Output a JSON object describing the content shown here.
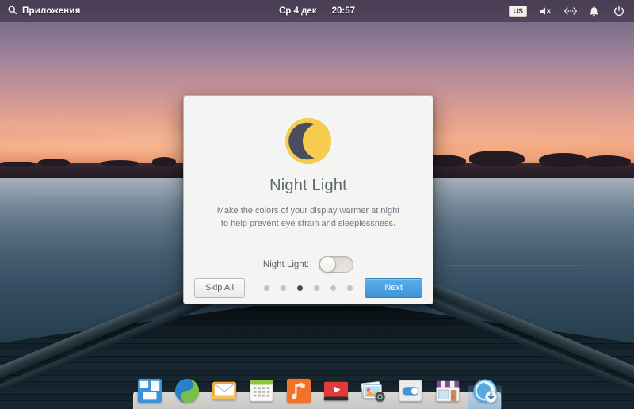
{
  "panel": {
    "apps_menu": {
      "label": "Приложения",
      "icon": "search-icon"
    },
    "clock": {
      "date": "Ср 4 дек",
      "time": "20:57"
    },
    "tray": {
      "keyboard_layout": "us",
      "volume_icon": "speaker-muted-icon",
      "network_icon": "network-icon",
      "notifications_icon": "bell-icon",
      "power_icon": "power-icon"
    }
  },
  "dialog": {
    "icon": "night-light-moon-icon",
    "title": "Night Light",
    "description": "Make the colors of your display warmer at night to help prevent eye strain and sleeplessness.",
    "toggle": {
      "label": "Night Light:",
      "state": "off"
    },
    "skip_label": "Skip All",
    "next_label": "Next",
    "pagination": {
      "total": 6,
      "active_index": 2
    },
    "colors": {
      "accent": "#3d94d9",
      "moon_disc": "#f5cc4e",
      "moon_crescent": "#4a4d5e",
      "title_text": "#5d6671"
    }
  },
  "dock": {
    "items": [
      {
        "name": "window-tiles-icon",
        "selected": false
      },
      {
        "name": "web-browser-icon",
        "selected": false
      },
      {
        "name": "mail-icon",
        "selected": false
      },
      {
        "name": "calendar-icon",
        "selected": false
      },
      {
        "name": "music-icon",
        "selected": false
      },
      {
        "name": "video-player-icon",
        "selected": false
      },
      {
        "name": "photos-icon",
        "selected": false
      },
      {
        "name": "system-settings-icon",
        "selected": false
      },
      {
        "name": "app-store-icon",
        "selected": false
      },
      {
        "name": "updates-icon",
        "selected": true
      }
    ]
  },
  "wallpaper": {
    "description": "Sunset over a lake seen from a wooden pier",
    "sky_top_color": "#6e5f7e",
    "sunset_color": "#f3a77f",
    "water_color": "#334b60",
    "pier_color": "#14222c"
  }
}
